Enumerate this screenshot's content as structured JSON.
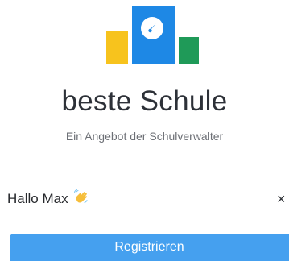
{
  "app": {
    "logo_icon": "logo-icon",
    "title": "beste Schule",
    "subtitle": "Ein Angebot der Schulverwalter"
  },
  "greeting": {
    "text": "Hallo Max",
    "emoji_icon": "waving-hand-icon",
    "close_symbol": "×"
  },
  "actions": {
    "register_label": "Registrieren"
  },
  "colors": {
    "accent_blue": "#1e88e5",
    "button_blue": "#45a0ef",
    "logo_yellow": "#f7c31d",
    "logo_green": "#1f9a58"
  }
}
